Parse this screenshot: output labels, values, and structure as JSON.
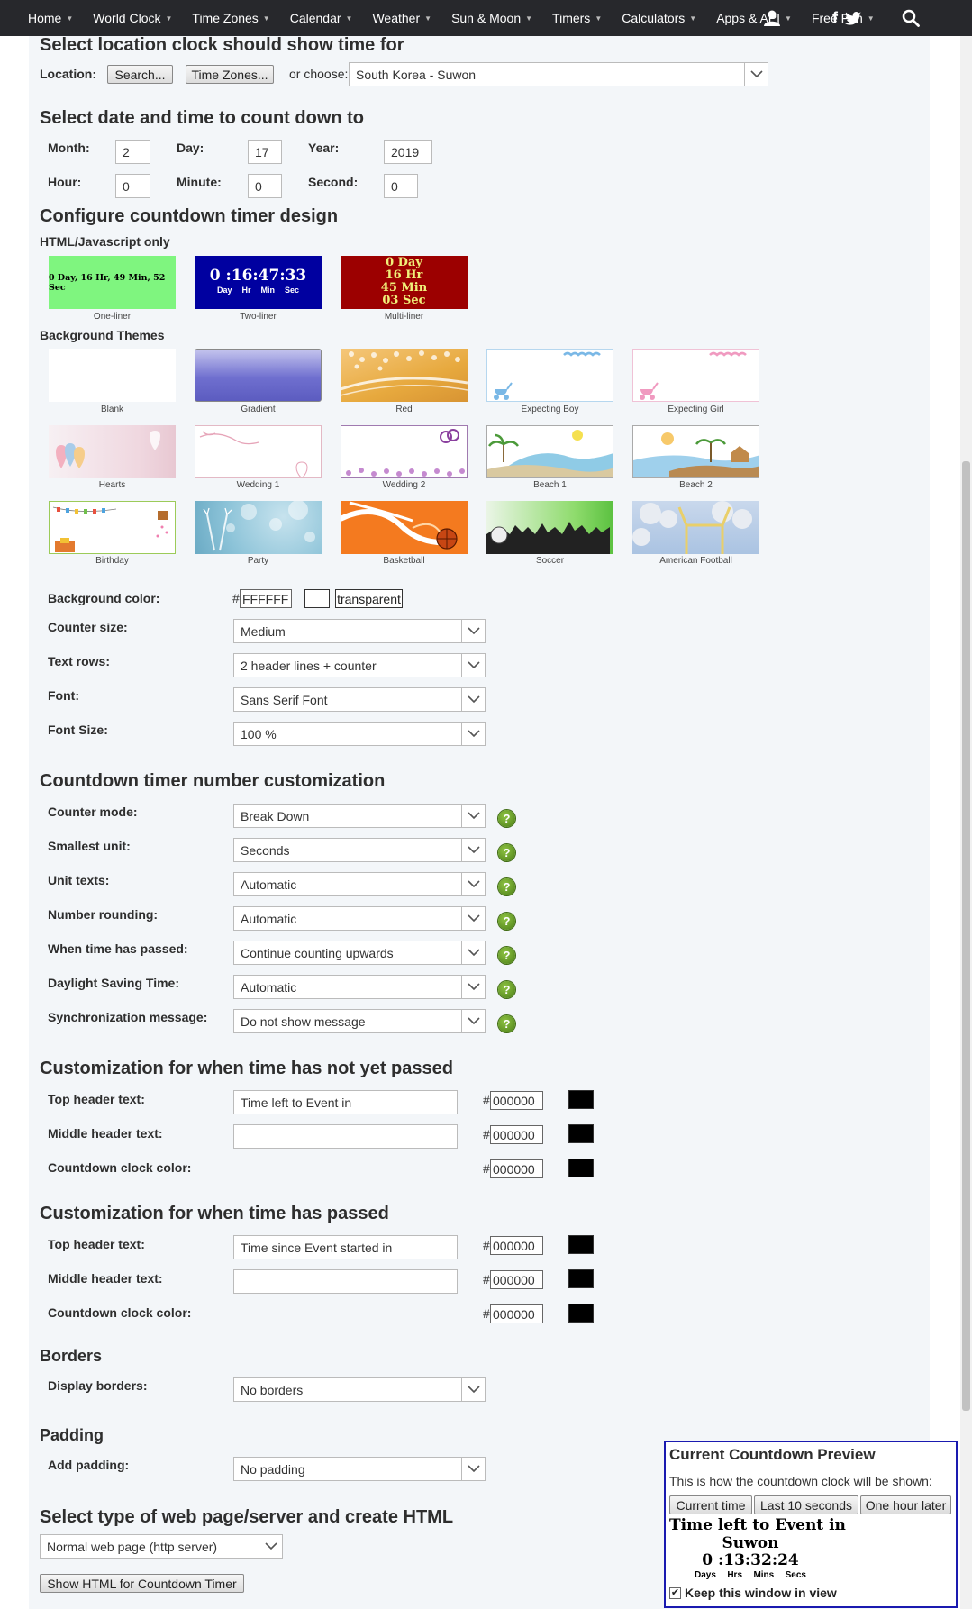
{
  "nav": {
    "items": [
      "Home",
      "World Clock",
      "Time Zones",
      "Calendar",
      "Weather",
      "Sun & Moon",
      "Timers",
      "Calculators",
      "Apps & API",
      "Free Fun"
    ],
    "facebook_glyph": "f"
  },
  "location": {
    "heading": "Select location clock should show time for",
    "label": "Location:",
    "search_button": "Search...",
    "timezones_button": "Time Zones...",
    "or_choose": "or choose:",
    "selected": "South Korea - Suwon"
  },
  "date": {
    "heading": "Select date and time to count down to",
    "month_label": "Month:",
    "month": "2",
    "day_label": "Day:",
    "day": "17",
    "year_label": "Year:",
    "year": "2019",
    "hour_label": "Hour:",
    "hour": "0",
    "minute_label": "Minute:",
    "minute": "0",
    "second_label": "Second:",
    "second": "0"
  },
  "design": {
    "heading": "Configure countdown timer design",
    "html_js_heading": "HTML/Javascript only",
    "one_liner_text": "0 Day, 16 Hr, 49 Min, 52 Sec",
    "two_liner_time": "0 :16:47:33",
    "two_liner_units": [
      "Day",
      "Hr",
      "Min",
      "Sec"
    ],
    "multi_liner_lines": [
      "0 Day",
      "16 Hr",
      "45 Min",
      "03 Sec"
    ],
    "html_js_captions": [
      "One-liner",
      "Two-liner",
      "Multi-liner"
    ],
    "themes_heading": "Background Themes",
    "themes": [
      "Blank",
      "Gradient",
      "Red",
      "Expecting Boy",
      "Expecting Girl",
      "Hearts",
      "Wedding 1",
      "Wedding 2",
      "Beach 1",
      "Beach 2",
      "Birthday",
      "Party",
      "Basketball",
      "Soccer",
      "American Football"
    ],
    "bg_color_label": "Background color:",
    "bg_color_value": "FFFFFF",
    "transparent_label": "transparent",
    "counter_size_label": "Counter size:",
    "counter_size": "Medium",
    "text_rows_label": "Text rows:",
    "text_rows": "2 header lines + counter",
    "font_label": "Font:",
    "font": "Sans Serif Font",
    "font_size_label": "Font Size:",
    "font_size": "100 %"
  },
  "number": {
    "heading": "Countdown timer number customization",
    "counter_mode_label": "Counter mode:",
    "counter_mode": "Break Down",
    "smallest_unit_label": "Smallest unit:",
    "smallest_unit": "Seconds",
    "unit_texts_label": "Unit texts:",
    "unit_texts": "Automatic",
    "rounding_label": "Number rounding:",
    "rounding": "Automatic",
    "passed_label": "When time has passed:",
    "passed": "Continue counting upwards",
    "dst_label": "Daylight Saving Time:",
    "dst": "Automatic",
    "sync_label": "Synchronization message:",
    "sync": "Do not show message",
    "help_glyph": "?"
  },
  "not_passed": {
    "heading": "Customization for when time has not yet passed",
    "top_label": "Top header text:",
    "top_value": "Time left to Event in",
    "middle_label": "Middle header text:",
    "middle_value": "",
    "clock_label": "Countdown clock color:",
    "hash": "#",
    "top_color": "000000",
    "middle_color": "000000",
    "clock_color": "000000"
  },
  "passed": {
    "heading": "Customization for when time has passed",
    "top_label": "Top header text:",
    "top_value": "Time since Event started in",
    "middle_label": "Middle header text:",
    "middle_value": "",
    "clock_label": "Countdown clock color:",
    "hash": "#",
    "top_color": "000000",
    "middle_color": "000000",
    "clock_color": "000000"
  },
  "borders": {
    "heading": "Borders",
    "label": "Display borders:",
    "value": "No borders"
  },
  "padding": {
    "heading": "Padding",
    "label": "Add padding:",
    "value": "No padding"
  },
  "server": {
    "heading": "Select type of web page/server and create HTML",
    "value": "Normal web page (http server)",
    "show_button": "Show HTML for Countdown Timer"
  },
  "preview": {
    "title": "Current Countdown Preview",
    "description": "This is how the countdown clock will be shown:",
    "buttons": [
      "Current time",
      "Last 10 seconds",
      "One hour later"
    ],
    "header": "Time left to Event in",
    "middle": "Suwon",
    "time": "0 :13:32:24",
    "units": [
      "Days",
      "Hrs",
      "Mins",
      "Secs"
    ],
    "keep_label": "Keep this window in view",
    "keep_checked": true
  },
  "colors": {
    "nav_bg": "#27282c",
    "panel_bg": "#f3f6f9",
    "preview_border": "#1a1ab0",
    "help_green": "#5a9a1c"
  }
}
